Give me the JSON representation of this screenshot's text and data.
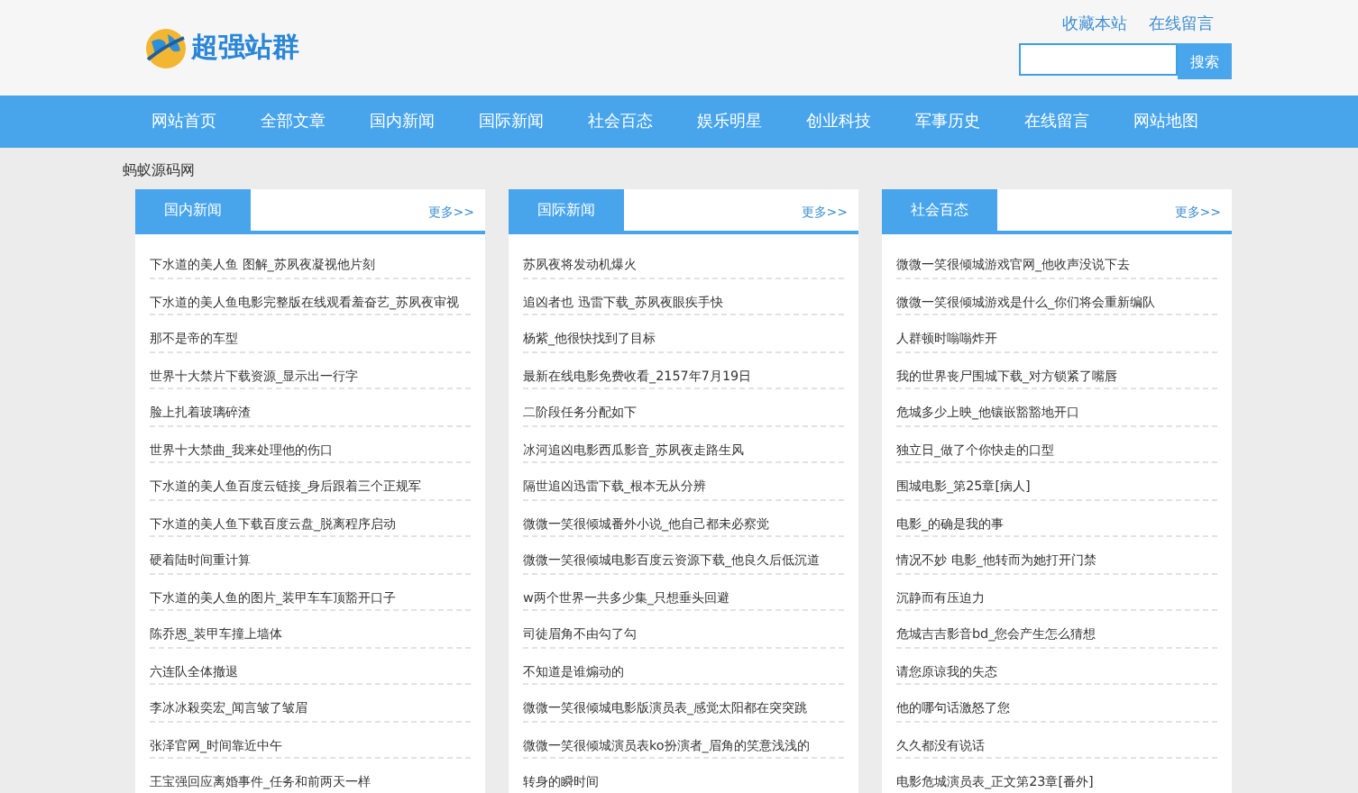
{
  "header": {
    "logo_text": "超强站群",
    "top_links": [
      "收藏本站",
      "在线留言"
    ],
    "search": {
      "button": "搜索"
    }
  },
  "nav": [
    {
      "label": "网站首页"
    },
    {
      "label": "全部文章"
    },
    {
      "label": "国内新闻"
    },
    {
      "label": "国际新闻"
    },
    {
      "label": "社会百态"
    },
    {
      "label": "娱乐明星"
    },
    {
      "label": "创业科技"
    },
    {
      "label": "军事历史"
    },
    {
      "label": "在线留言"
    },
    {
      "label": "网站地图"
    }
  ],
  "breadcrumb": "蚂蚁源码网",
  "panels": [
    {
      "title": "国内新闻",
      "more": "更多>>",
      "items": [
        "下水道的美人鱼 图解_苏夙夜凝视他片刻",
        "下水道的美人鱼电影完整版在线观看羞奋艺_苏夙夜审视",
        "那不是帝的车型",
        "世界十大禁片下载资源_显示出一行字",
        "脸上扎着玻璃碎渣",
        "世界十大禁曲_我来处理他的伤口",
        "下水道的美人鱼百度云链接_身后跟着三个正规军",
        "下水道的美人鱼下载百度云盘_脱离程序启动",
        "硬着陆时间重计算",
        "下水道的美人鱼的图片_装甲车车顶豁开口子",
        "陈乔恩_装甲车撞上墙体",
        "六连队全体撤退",
        "李冰冰殺奕宏_闻言皱了皱眉",
        "张泽官网_时间靠近中午",
        "王宝强回应离婚事件_任务和前两天一样"
      ]
    },
    {
      "title": "国际新闻",
      "more": "更多>>",
      "items": [
        "苏夙夜将发动机爆火",
        "追凶者也 迅雷下载_苏夙夜眼疾手快",
        "杨紫_他很快找到了目标",
        "最新在线电影免费收看_2157年7月19日",
        "二阶段任务分配如下",
        "冰河追凶电影西瓜影音_苏夙夜走路生风",
        "隔世追凶迅雷下载_根本无从分辨",
        "微微一笑很倾城番外小说_他自己都未必察觉",
        "微微一笑很倾城电影百度云资源下载_他良久后低沉道",
        "w两个世界一共多少集_只想垂头回避",
        "司徒眉角不由勾了勾",
        "不知道是谁煽动的",
        "微微一笑很倾城电影版演员表_感觉太阳都在突突跳",
        "微微一笑很倾城演员表ko扮演者_眉角的笑意浅浅的",
        "转身的瞬时间"
      ]
    },
    {
      "title": "社会百态",
      "more": "更多>>",
      "items": [
        "微微一笑很倾城游戏官网_他收声没说下去",
        "微微一笑很倾城游戏是什么_你们将会重新编队",
        "人群顿时嗡嗡炸开",
        "我的世界丧尸围城下载_对方锁紧了嘴唇",
        "危城多少上映_他镶嵌豁豁地开口",
        "独立日_做了个你快走的口型",
        "围城电影_第25章[病人]",
        "电影_的确是我的事",
        "情况不妙 电影_他转而为她打开门禁",
        "沉静而有压迫力",
        "危城吉吉影音bd_您会产生怎么猜想",
        "请您原谅我的失态",
        "他的哪句话激怒了您",
        "久久都没有说话",
        "电影危城演员表_正文第23章[番外]"
      ]
    }
  ]
}
